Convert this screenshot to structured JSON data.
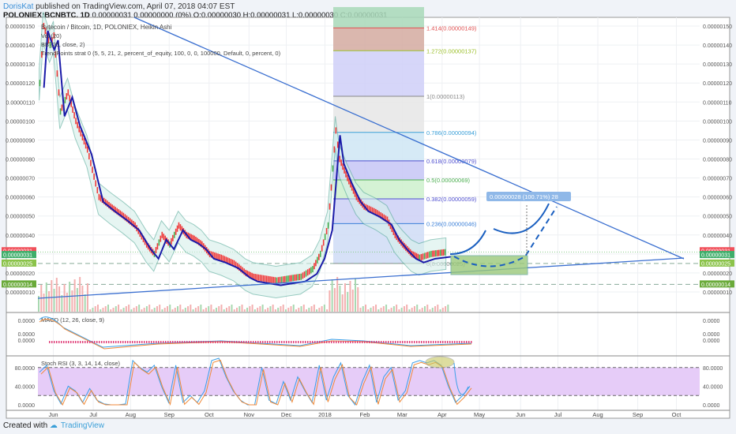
{
  "header": {
    "author": "DorisKat",
    "published": "published on TradingView.com, April 07, 2018 04:07 EST",
    "symbol": "POLONIEX:BCNBTC, 1D",
    "last": "0.00000031 0.00000000 (0%)",
    "ohlc": "O:0.00000030 H:0.00000031 L:0.00000030 C:0.00000031"
  },
  "footer": {
    "created": "Created with",
    "brand": "TradingView"
  },
  "chart_data": {
    "type": "line",
    "title": "Bytecoin / Bitcoin, 1D, POLONIEX, Heikin Ashi",
    "indicator_labels": [
      "Vol (20)",
      "BB (20, close, 2)",
      "TrendPoints strat 0 (5, 5, 21, 2, percent_of_equity, 100, 0, 0, 100000, Default, 0, percent, 0)"
    ],
    "price_scale_labels": [
      "0.00000150",
      "0.00000140",
      "0.00000130",
      "0.00000120",
      "0.00000110",
      "0.00000100",
      "0.00000090",
      "0.00000080",
      "0.00000070",
      "0.00000060",
      "0.00000050",
      "0.00000040",
      "0.00000030",
      "0.00000020",
      "0.00000010"
    ],
    "price_ticks": [
      150,
      140,
      130,
      120,
      110,
      100,
      90,
      80,
      70,
      60,
      50,
      40,
      30,
      20,
      10
    ],
    "price_badges": [
      {
        "label": "0.00000031",
        "value": 31.5,
        "color": "#f0505a"
      },
      {
        "label": "0.00000031",
        "value": 29.5,
        "color": "#3fae6a"
      },
      {
        "label": "0.00000025",
        "value": 25,
        "color": "#8bc34a"
      },
      {
        "label": "0.00000014",
        "value": 14,
        "color": "#6aaa3a"
      }
    ],
    "x_ticks": [
      "Jun",
      "Jul",
      "Aug",
      "Sep",
      "Oct",
      "Nov",
      "Dec",
      "2018",
      "Feb",
      "Mar",
      "Apr",
      "May",
      "Jun",
      "Jul",
      "Aug",
      "Sep",
      "Oct"
    ],
    "x_tick_days": [
      12,
      43,
      72,
      102,
      133,
      164,
      193,
      223,
      254,
      283,
      314,
      343,
      375,
      404,
      435,
      466,
      496
    ],
    "price_series": {
      "days": [
        1,
        4,
        9,
        12,
        17,
        23,
        29,
        38,
        47,
        56,
        66,
        75,
        84,
        90,
        96,
        102,
        109,
        115,
        121,
        127,
        133,
        142,
        152,
        161,
        167,
        176,
        185,
        194,
        204,
        213,
        219,
        225,
        231,
        234,
        240,
        247,
        253,
        262,
        271,
        277,
        283,
        290,
        296,
        305,
        317
      ],
      "values": [
        120,
        150,
        140,
        145,
        105,
        115,
        100,
        85,
        60,
        55,
        50,
        45,
        35,
        30,
        40,
        35,
        45,
        40,
        38,
        35,
        30,
        28,
        25,
        20,
        18,
        17,
        16,
        17,
        18,
        22,
        30,
        45,
        95,
        80,
        70,
        60,
        55,
        52,
        48,
        40,
        35,
        30,
        28,
        30,
        31
      ]
    },
    "fib_levels": [
      {
        "label": "1.414(0.00000149)",
        "value": 149,
        "color": "#e05050"
      },
      {
        "label": "1.272(0.00000137)",
        "value": 137,
        "color": "#9bbf2a"
      },
      {
        "label": "1(0.00000113)",
        "value": 113,
        "color": "#888888"
      },
      {
        "label": "0.786(0.00000094)",
        "value": 94,
        "color": "#3a9fd8"
      },
      {
        "label": "0.618(0.00000079)",
        "value": 79,
        "color": "#5050d0"
      },
      {
        "label": "0.5(0.00000069)",
        "value": 69,
        "color": "#4caf50"
      },
      {
        "label": "0.382(0.00000059)",
        "value": 59,
        "color": "#5050d0"
      },
      {
        "label": "0.236(0.00000046)",
        "value": 46,
        "color": "#3a7fd8"
      },
      {
        "label": "0(0.00000025)",
        "value": 25,
        "color": "#888888"
      }
    ],
    "projection_label": "0.00000028 (100.71%) 28",
    "macd": {
      "title": "MACD (12, 26, close, 9)",
      "scale_labels": [
        "0.0000",
        "0.0000",
        "0.0000"
      ]
    },
    "stoch_rsi": {
      "title": "Stoch RSI (3, 3, 14, 14, close)",
      "scale_labels": [
        "80.0000",
        "40.0000",
        "0.0000"
      ],
      "bands": [
        80,
        20
      ],
      "values": [
        70,
        85,
        30,
        2,
        40,
        30,
        5,
        35,
        10,
        2,
        0,
        0,
        2,
        95,
        80,
        70,
        85,
        40,
        5,
        85,
        5,
        20,
        5,
        30,
        95,
        100,
        60,
        30,
        10,
        0,
        0,
        80,
        10,
        2,
        50,
        10,
        60,
        30,
        5,
        85,
        10,
        60,
        90,
        20,
        0,
        50,
        85,
        5,
        60,
        80,
        10,
        30,
        90,
        95,
        90,
        95,
        85,
        40,
        5,
        20,
        40
      ]
    }
  }
}
